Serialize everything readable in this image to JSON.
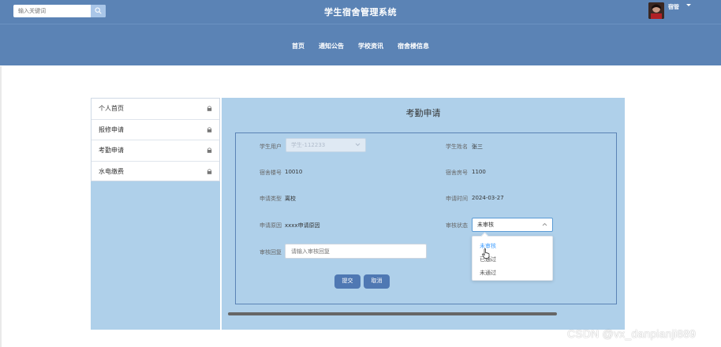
{
  "header": {
    "search_placeholder": "输入关键词",
    "site_title": "学生宿舍管理系统",
    "user_name": "宿管"
  },
  "nav": {
    "items": [
      "首页",
      "通知公告",
      "学校资讯",
      "宿舍楼信息"
    ]
  },
  "sidebar": {
    "items": [
      "个人首页",
      "报修申请",
      "考勤申请",
      "水电缴费"
    ]
  },
  "form": {
    "title": "考勤申请",
    "student_user_label": "学生用户",
    "student_user_value": "学生-112233",
    "student_name_label": "学生姓名",
    "student_name_value": "张三",
    "building_label": "宿舍楼号",
    "building_value": "10010",
    "room_label": "宿舍房号",
    "room_value": "1100",
    "type_label": "申请类型",
    "type_value": "离校",
    "time_label": "申请时间",
    "time_value": "2024-03-27",
    "reason_label": "申请原因",
    "reason_value": "xxxx申请原因",
    "status_label": "审核状态",
    "status_value": "未审核",
    "reply_label": "审核回复",
    "reply_placeholder": "请输入审核回复",
    "submit_label": "提交",
    "cancel_label": "取消"
  },
  "status_dropdown": {
    "options": [
      "未审核",
      "已通过",
      "未通过"
    ],
    "selected": "未审核"
  },
  "watermark": "CSDN @vx_danpianji889",
  "colors": {
    "header_bg": "#5b83b5",
    "panel_bg": "#afd0ea",
    "button_bg": "#4f78b3",
    "active_option": "#409eff"
  },
  "icons": {
    "search": "search-icon",
    "caret": "caret-down-icon",
    "lock": "lock-icon",
    "chevron": "chevron-down-icon",
    "cursor": "hand-cursor-icon"
  }
}
